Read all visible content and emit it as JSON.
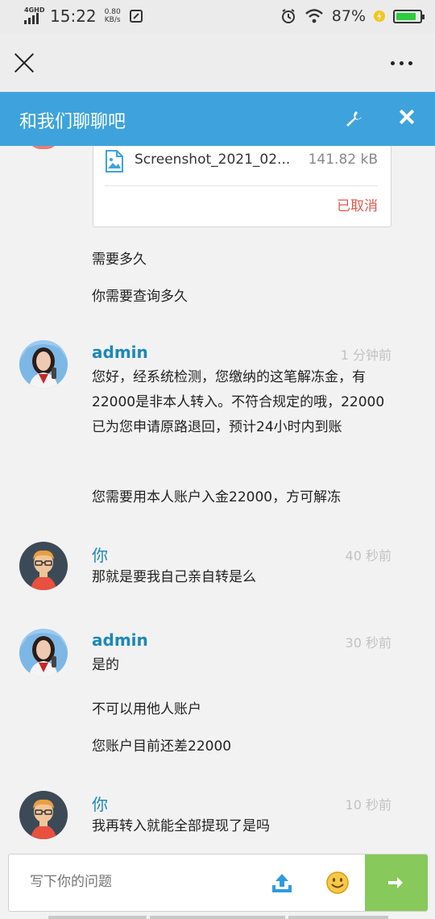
{
  "status_bar": {
    "network_tag": "4GHD",
    "time": "15:22",
    "speed_value": "0.80",
    "speed_unit": "KB/s",
    "battery": "87%",
    "battery_level": 0.87
  },
  "chat_header": {
    "title": "和我们聊聊吧"
  },
  "file_card": {
    "file_name": "Screenshot_2021_02...",
    "file_size": "141.82 kB",
    "status": "已取消"
  },
  "messages": [
    {
      "sender": "",
      "time": "",
      "lines": [
        "需要多久",
        "你需要查询多久"
      ]
    },
    {
      "sender": "admin",
      "time": "1 分钟前",
      "lines": [
        "您好，经系统检测，您缴纳的这笔解冻金，有22000是非本人转入。不符合规定的哦，22000已为您申请原路退回，预计24小时内到账",
        "您需要用本人账户入金22000，方可解冻"
      ]
    },
    {
      "sender": "你",
      "time": "40 秒前",
      "lines": [
        "那就是要我自己亲自转是么"
      ]
    },
    {
      "sender": "admin",
      "time": "30 秒前",
      "lines": [
        "是的",
        "不可以用他人账户",
        "您账户目前还差22000"
      ]
    },
    {
      "sender": "你",
      "time": "10 秒前",
      "lines": [
        "我再转入就能全部提现了是吗"
      ]
    }
  ],
  "input": {
    "placeholder": "写下你的问题"
  },
  "colors": {
    "header": "#3ea3dc",
    "sender_name": "#1c88b8",
    "cancel_status": "#e0584c",
    "send_button": "#87c95a"
  }
}
